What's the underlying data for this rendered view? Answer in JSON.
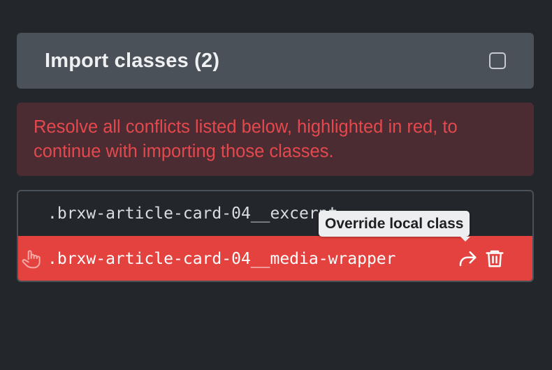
{
  "header": {
    "title": "Import classes (2)",
    "checkbox_checked": false
  },
  "notice": {
    "text": "Resolve all conflicts listed below, highlighted in red, to continue with importing those classes.",
    "color": "#e5484d"
  },
  "classes": [
    {
      "name": ".brxw-article-card-04__excerpt",
      "conflict": false
    },
    {
      "name": ".brxw-article-card-04__media-wrapper",
      "conflict": true
    }
  ],
  "row_actions": {
    "override_icon": "share-forward-icon",
    "delete_icon": "trash-icon",
    "drag_icon": "grab-hand-icon"
  },
  "tooltip": {
    "text": "Override local class"
  },
  "colors": {
    "background": "#23262a",
    "header": "#4a5159",
    "conflict_row": "#e3423e"
  }
}
